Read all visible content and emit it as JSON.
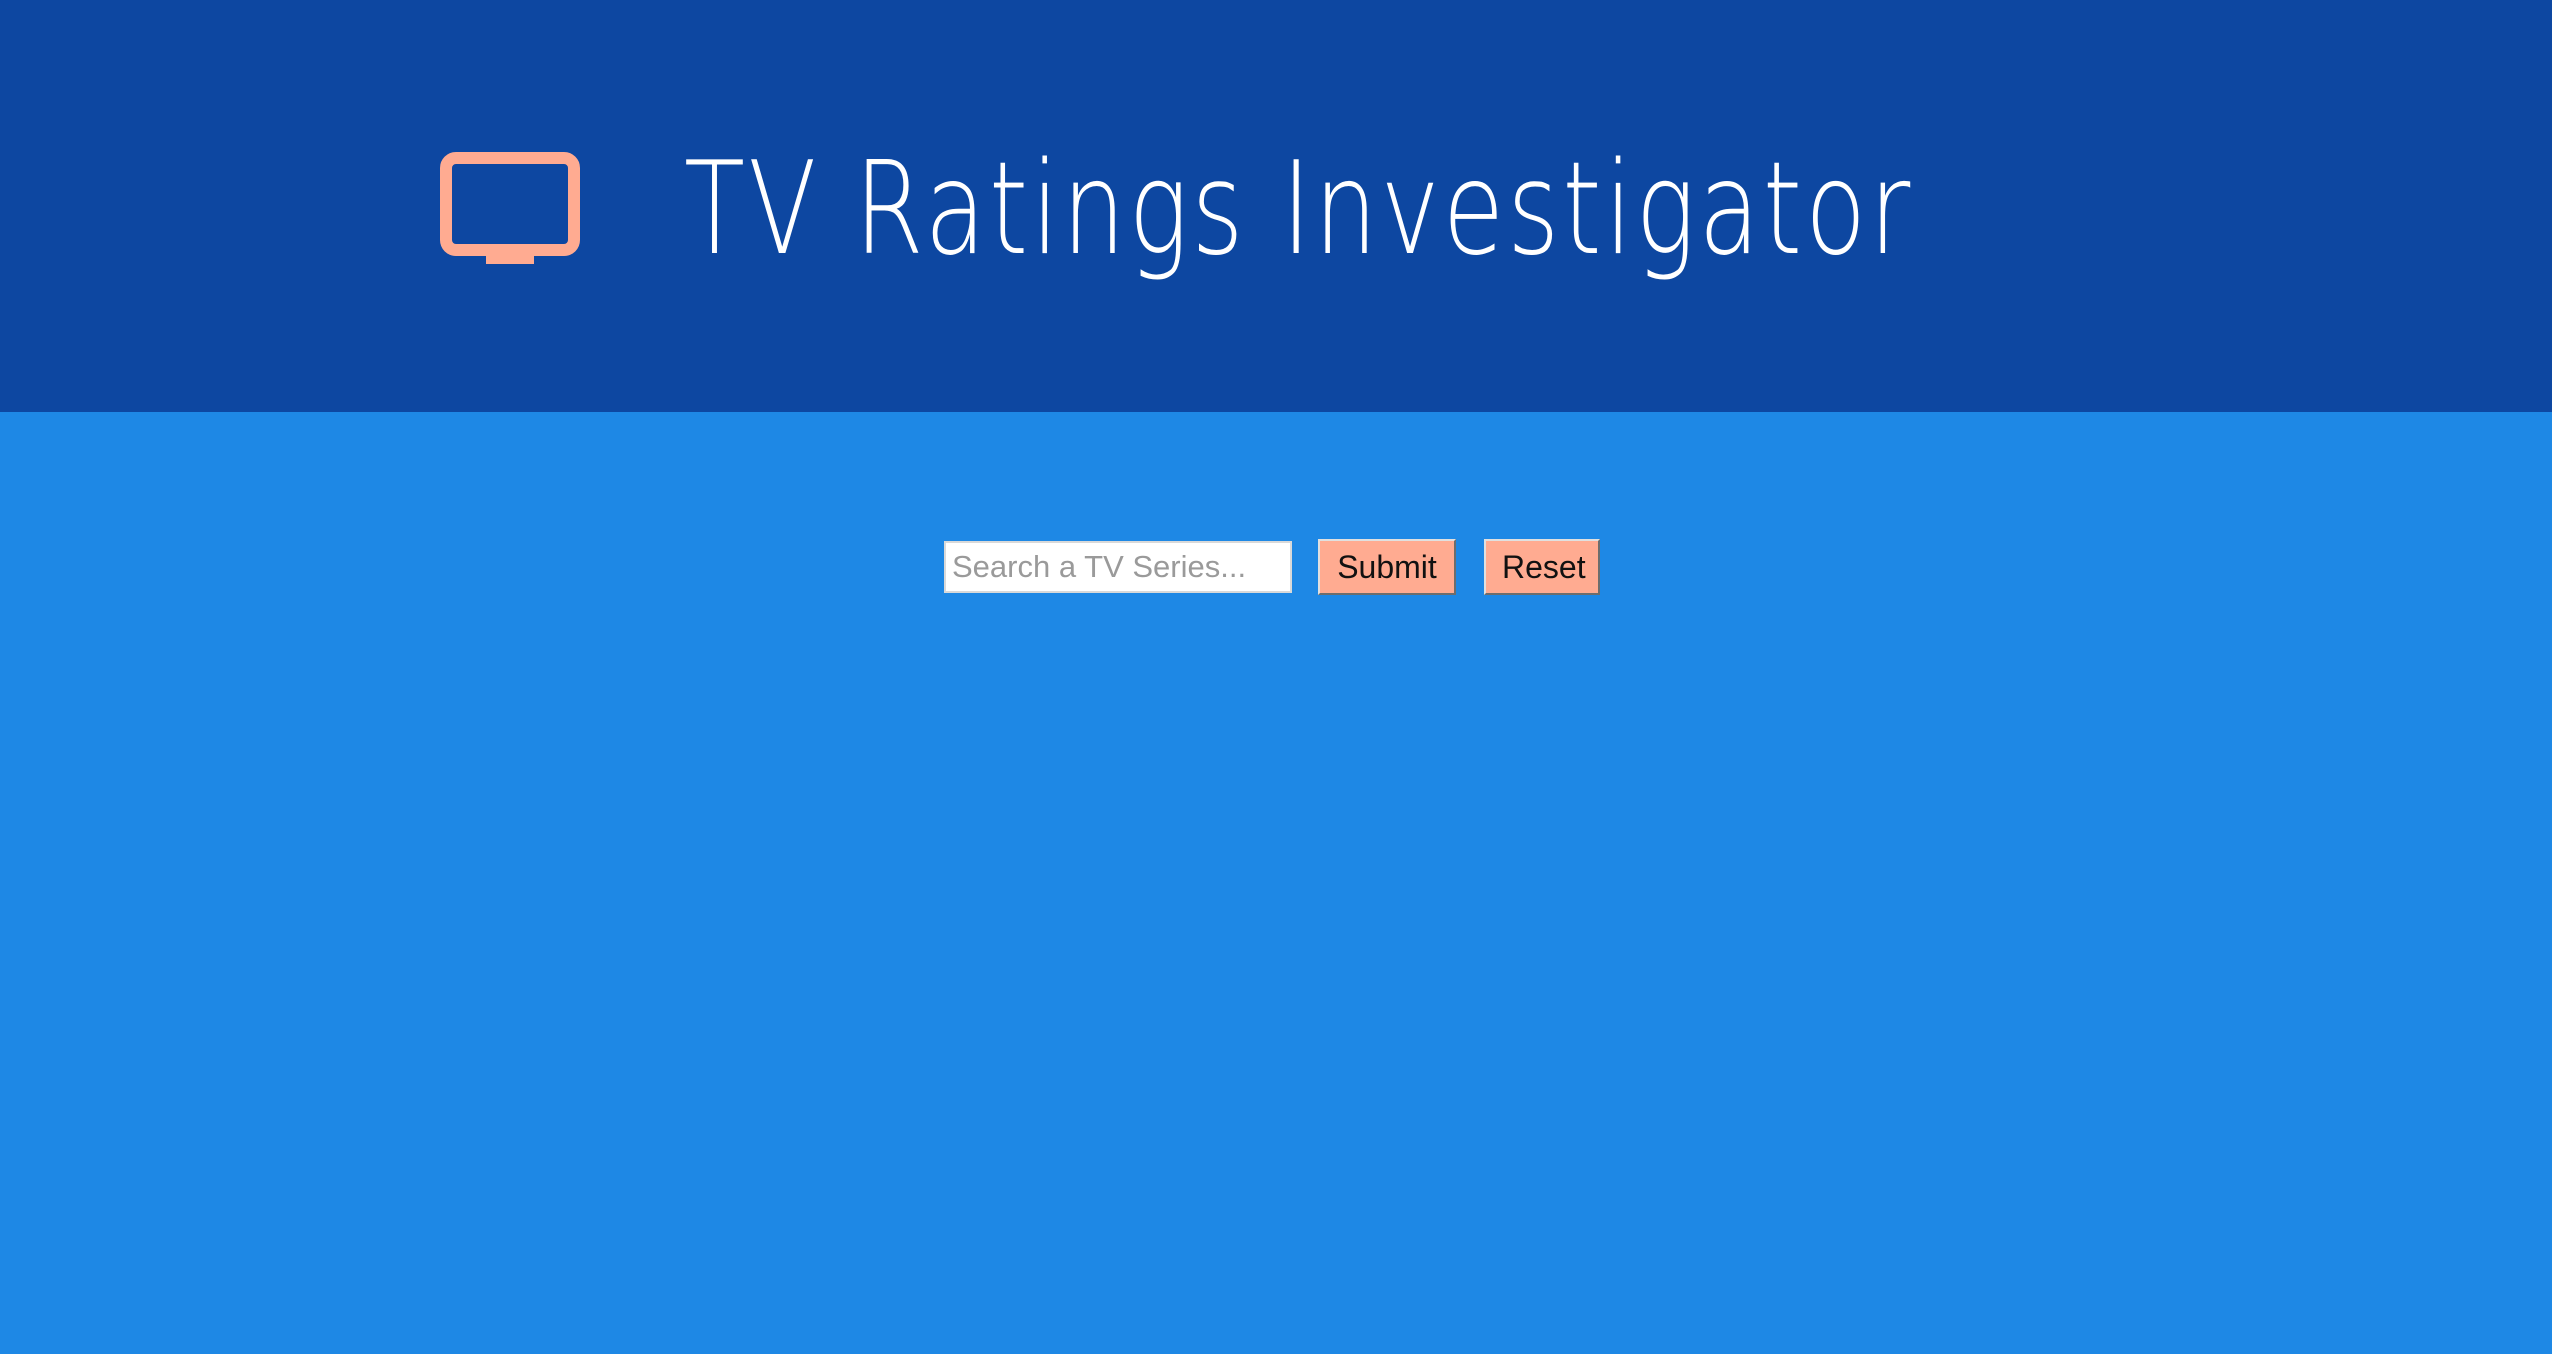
{
  "header": {
    "title": "TV Ratings Investigator",
    "icon": "tv-icon",
    "icon_color": "#ffab91",
    "background": "#0d47a1"
  },
  "search": {
    "placeholder": "Search a TV Series...",
    "value": "",
    "submit_label": "Submit",
    "reset_label": "Reset"
  },
  "colors": {
    "page_background": "#1e88e5",
    "button_background": "#ffab91"
  }
}
